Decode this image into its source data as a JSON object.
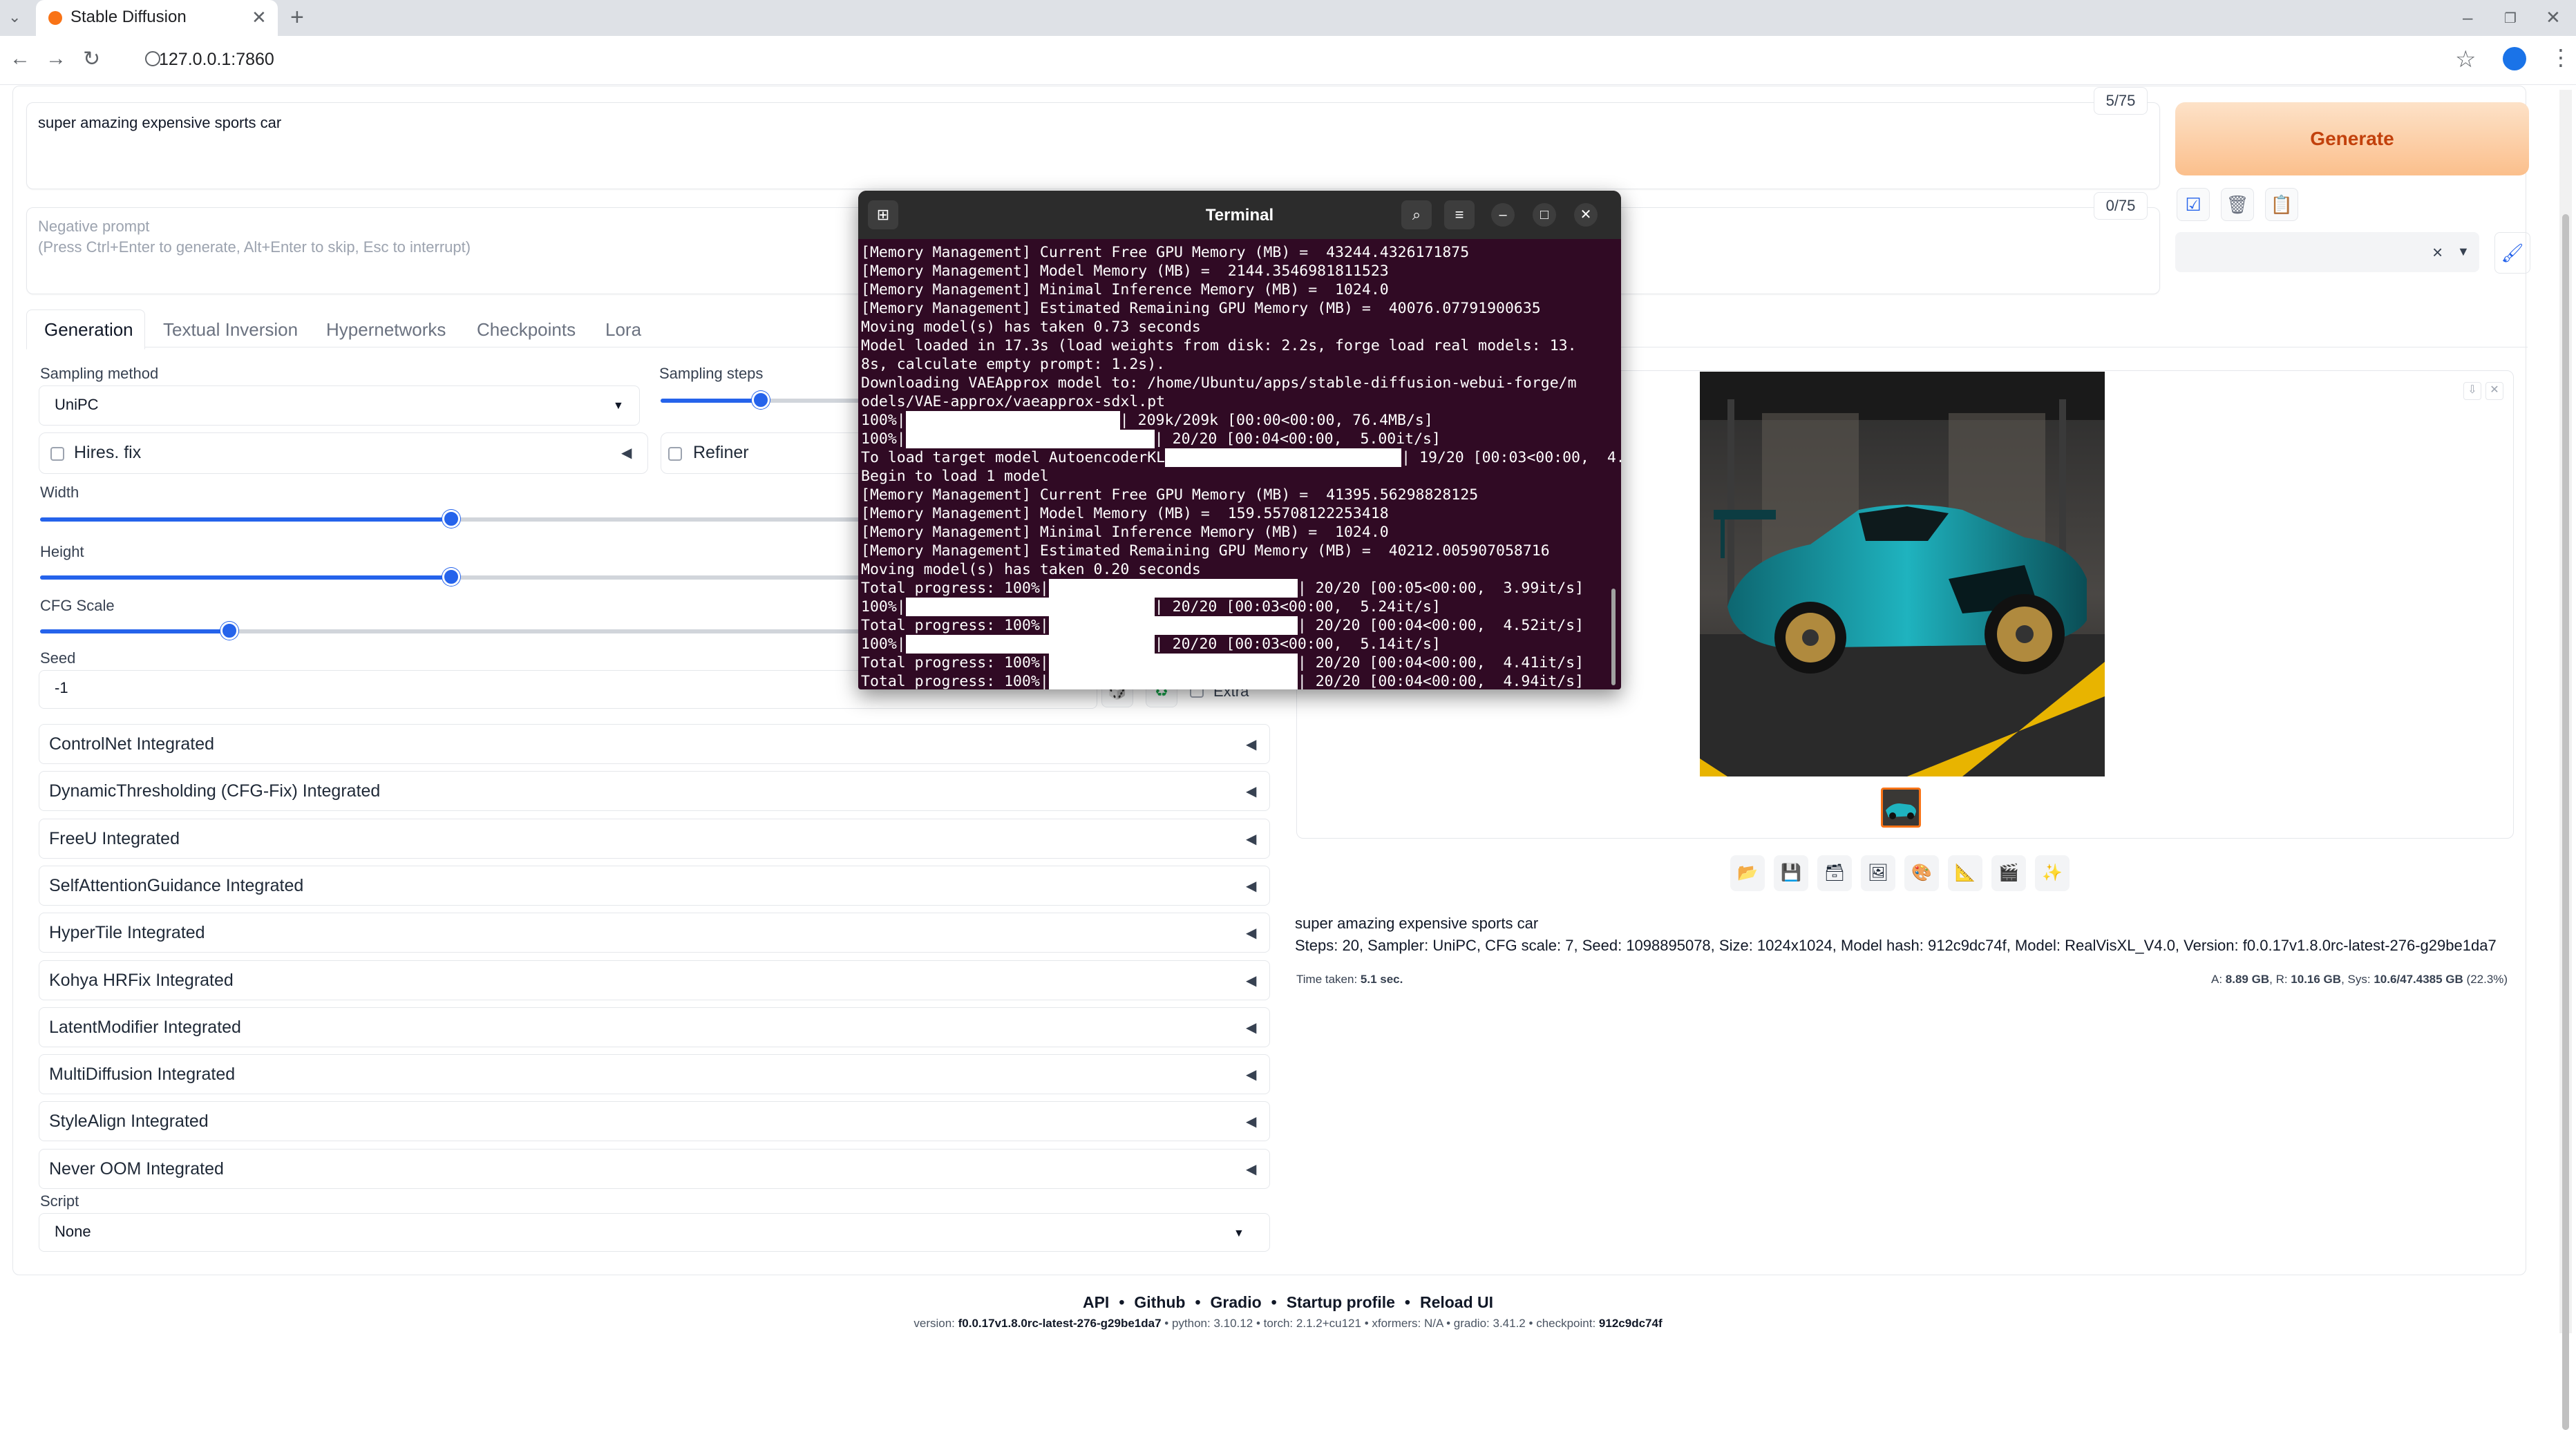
{
  "browser": {
    "tab_title": "Stable Diffusion",
    "tab_close": "✕",
    "new_tab": "+",
    "url": "127.0.0.1:7860"
  },
  "prompt": {
    "text": "super amazing expensive sports car",
    "counter": "5/75"
  },
  "negative_prompt": {
    "placeholder_line1": "Negative prompt",
    "placeholder_line2": "(Press Ctrl+Enter to generate, Alt+Enter to skip, Esc to interrupt)",
    "counter": "0/75"
  },
  "generate_label": "Generate",
  "tool_icons": [
    "check-square-icon",
    "trash-icon",
    "clipboard-icon"
  ],
  "tabs": [
    "Generation",
    "Textual Inversion",
    "Hypernetworks",
    "Checkpoints",
    "Lora"
  ],
  "params": {
    "sampling_method_label": "Sampling method",
    "sampling_method_value": "UniPC",
    "sampling_steps_label": "Sampling steps",
    "sampling_steps_fraction": 0.5,
    "hires_label": "Hires. fix",
    "refiner_label": "Refiner",
    "width_label": "Width",
    "width_fraction": 0.5,
    "height_label": "Height",
    "height_fraction": 0.5,
    "cfg_label": "CFG Scale",
    "cfg_fraction": 0.23,
    "seed_label": "Seed",
    "seed_value": "-1",
    "extra_label": "Extra"
  },
  "accordions": [
    "ControlNet Integrated",
    "DynamicThresholding (CFG-Fix) Integrated",
    "FreeU Integrated",
    "SelfAttentionGuidance Integrated",
    "HyperTile Integrated",
    "Kohya HRFix Integrated",
    "LatentModifier Integrated",
    "MultiDiffusion Integrated",
    "StyleAlign Integrated",
    "Never OOM Integrated"
  ],
  "script": {
    "label": "Script",
    "value": "None"
  },
  "output": {
    "prompt": "super amazing expensive sports car",
    "params": "Steps: 20, Sampler: UniPC, CFG scale: 7, Seed: 1098895078, Size: 1024x1024, Model hash: 912c9dc74f, Model: RealVisXL_V4.0, Version: f0.0.17v1.8.0rc-latest-276-g29be1da7",
    "time_label": "Time taken:",
    "time_value": "5.1 sec.",
    "mem_a_label": "A:",
    "mem_a_value": "8.89 GB",
    "mem_r_label": "R:",
    "mem_r_value": "10.16 GB",
    "mem_sys_label": "Sys:",
    "mem_sys_value": "10.6/47.4385 GB",
    "mem_pct": "(22.3%)",
    "action_icons": [
      "folder-icon",
      "save-icon",
      "zip-icon",
      "image-icon",
      "palette-icon",
      "ruler-icon",
      "film-icon",
      "sparkles-icon"
    ]
  },
  "terminal": {
    "title": "Terminal",
    "lines": [
      {
        "pre": "[Memory Management] Current Free GPU Memory (MB) =  43244.4326171875"
      },
      {
        "pre": "[Memory Management] Model Memory (MB) =  2144.3546981811523"
      },
      {
        "pre": "[Memory Management] Minimal Inference Memory (MB) =  1024.0"
      },
      {
        "pre": "[Memory Management] Estimated Remaining GPU Memory (MB) =  40076.07791900635"
      },
      {
        "pre": "Moving model(s) has taken 0.73 seconds"
      },
      {
        "pre": "Model loaded in 17.3s (load weights from disk: 2.2s, forge load real models: 13."
      },
      {
        "pre": "8s, calculate empty prompt: 1.2s)."
      },
      {
        "pre": "Downloading VAEApprox model to: /home/Ubuntu/apps/stable-diffusion-webui-forge/m"
      },
      {
        "pre": "odels/VAE-approx/vaeapprox-sdxl.pt"
      },
      {
        "pre": "100%|",
        "bar": 0.86,
        "post": "| 209k/209k [00:00<00:00, 76.4MB/s]"
      },
      {
        "pre": "100%|",
        "bar": 1.0,
        "post": "| 20/20 [00:04<00:00,  5.00it/s]"
      },
      {
        "pre": "To load target model AutoencoderKL",
        "bar": 0.95,
        "post": "| 19/20 [00:03<00:00,  4.91it/s]"
      },
      {
        "pre": "Begin to load 1 model"
      },
      {
        "pre": "[Memory Management] Current Free GPU Memory (MB) =  41395.56298828125"
      },
      {
        "pre": "[Memory Management] Model Memory (MB) =  159.55708122253418"
      },
      {
        "pre": "[Memory Management] Minimal Inference Memory (MB) =  1024.0"
      },
      {
        "pre": "[Memory Management] Estimated Remaining GPU Memory (MB) =  40212.005907058716"
      },
      {
        "pre": "Moving model(s) has taken 0.20 seconds"
      },
      {
        "pre": "Total progress: 100%|",
        "bar": 1.0,
        "post": "| 20/20 [00:05<00:00,  3.99it/s]"
      },
      {
        "pre": "100%|",
        "bar": 1.0,
        "post": "| 20/20 [00:03<00:00,  5.24it/s]"
      },
      {
        "pre": "Total progress: 100%|",
        "bar": 1.0,
        "post": "| 20/20 [00:04<00:00,  4.52it/s]"
      },
      {
        "pre": "100%|",
        "bar": 1.0,
        "post": "| 20/20 [00:03<00:00,  5.14it/s]"
      },
      {
        "pre": "Total progress: 100%|",
        "bar": 1.0,
        "post": "| 20/20 [00:04<00:00,  4.41it/s]"
      },
      {
        "pre": "Total progress: 100%|",
        "bar": 1.0,
        "post": "| 20/20 [00:04<00:00,  4.94it/s]"
      }
    ]
  },
  "footer": {
    "links": [
      "API",
      "Github",
      "Gradio",
      "Startup profile",
      "Reload UI"
    ],
    "separator": "•",
    "version_label": "version:",
    "version_value": "f0.0.17v1.8.0rc-latest-276-g29be1da7",
    "python_label": "python:",
    "python_value": "3.10.12",
    "torch_label": "torch:",
    "torch_value": "2.1.2+cu121",
    "xformers_label": "xformers:",
    "xformers_value": "N/A",
    "gradio_label": "gradio:",
    "gradio_value": "3.41.2",
    "checkpoint_label": "checkpoint:",
    "checkpoint_value": "912c9dc74f"
  }
}
